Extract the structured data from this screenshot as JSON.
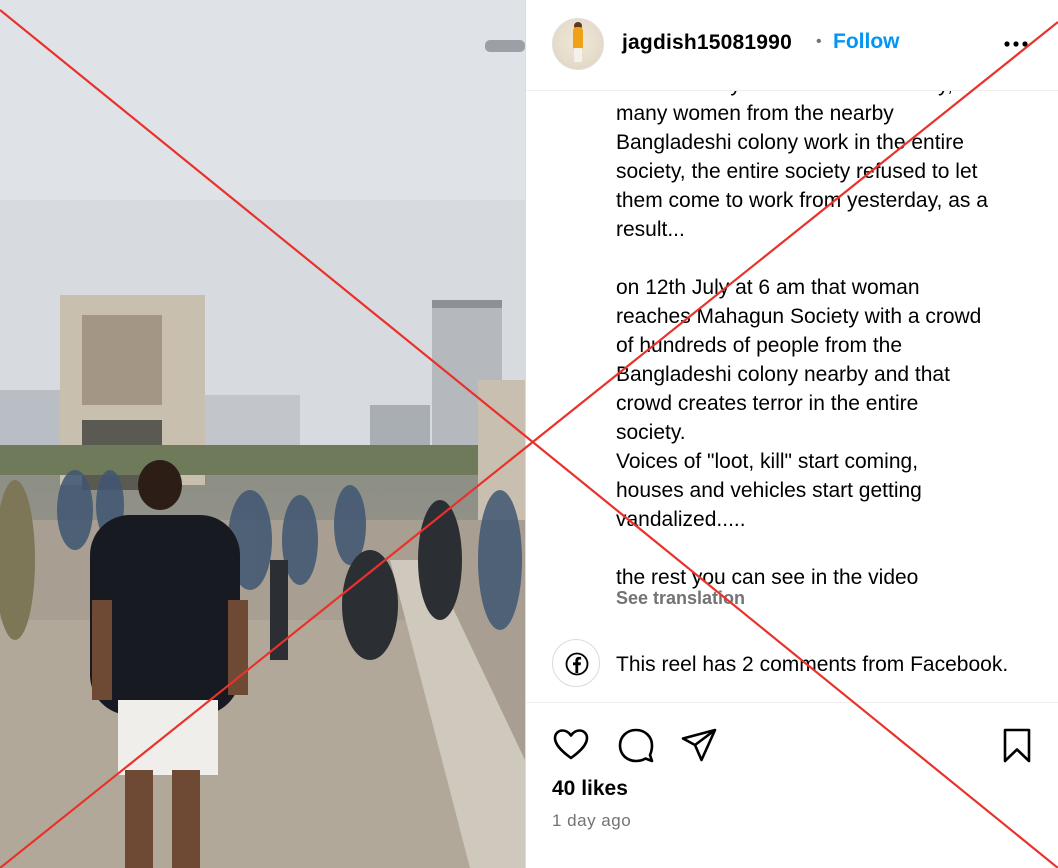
{
  "post": {
    "username": "jagdish15081990",
    "separator_dot": "•",
    "follow_label": "Follow",
    "more_icon": "more-horizontal-icon",
    "caption_paragraphs": [
      "but the family told this to the society,\nmany women from the nearby\nBangladeshi colony work in the entire\nsociety, the entire society refused to let\nthem come to work from yesterday, as a\nresult...",
      "on 12th July at 6 am that woman\nreaches Mahagun Society with a crowd\nof hundreds of people from the\nBangladeshi colony nearby and that\ncrowd creates terror in the entire\nsociety.\nVoices of \"loot, kill\" start coming,\nhouses and vehicles start getting\nvandalized.....",
      "the rest you can see in the video"
    ],
    "see_translation": "See translation",
    "facebook_comments_text": "This reel has 2 comments from Facebook.",
    "likes": "40 likes",
    "time_ago": "1 day ago"
  },
  "icons": {
    "like": "heart-icon",
    "comment": "comment-icon",
    "share": "send-icon",
    "save": "bookmark-icon",
    "facebook": "facebook-icon"
  },
  "colors": {
    "follow_blue": "#0095f6",
    "secondary_text": "#737373",
    "overlay_cross": "#e8322b"
  }
}
